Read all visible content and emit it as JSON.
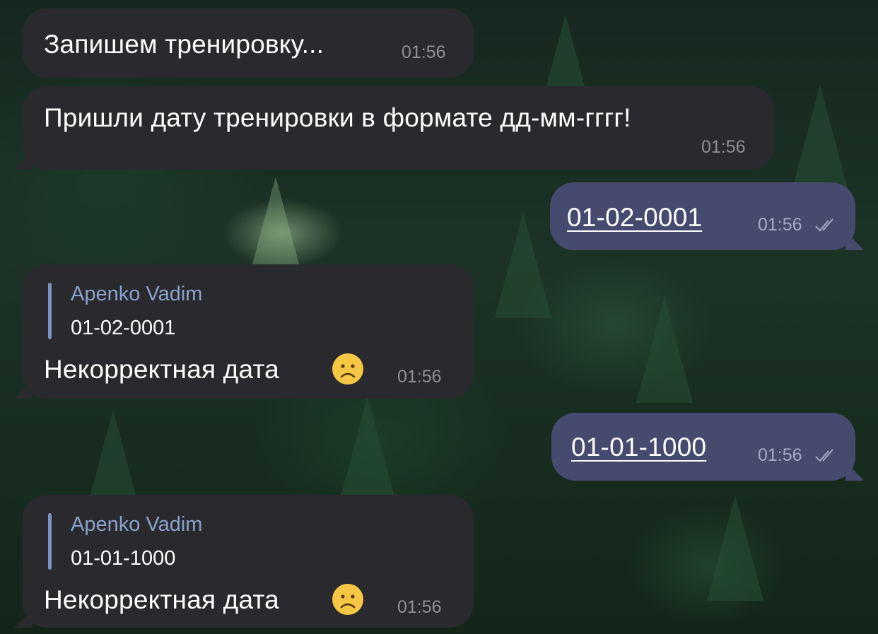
{
  "messages": [
    {
      "id": "m1",
      "direction": "incoming",
      "text": "Запишем тренировку...",
      "time": "01:56"
    },
    {
      "id": "m2",
      "direction": "incoming",
      "text": "Пришли дату тренировки в формате дд-мм-гггг!",
      "time": "01:56"
    },
    {
      "id": "m3",
      "direction": "outgoing",
      "text": "01-02-0001",
      "time": "01:56",
      "status": "read"
    },
    {
      "id": "m4",
      "direction": "incoming",
      "reply_to": {
        "author": "Apenko Vadim",
        "text": "01-02-0001"
      },
      "text": "Некорректная дата",
      "emoji": "frowning-face",
      "time": "01:56"
    },
    {
      "id": "m5",
      "direction": "outgoing",
      "text": "01-01-1000",
      "time": "01:56",
      "status": "read"
    },
    {
      "id": "m6",
      "direction": "incoming",
      "reply_to": {
        "author": "Apenko Vadim",
        "text": "01-01-1000"
      },
      "text": "Некорректная дата",
      "emoji": "frowning-face",
      "time": "01:56"
    }
  ],
  "colors": {
    "incoming_bubble": "#2a2a2e",
    "outgoing_bubble": "#464a6e",
    "reply_accent": "#8aa2cc",
    "timestamp": "#8e8e96"
  },
  "background": "dark pine forest wallpaper"
}
